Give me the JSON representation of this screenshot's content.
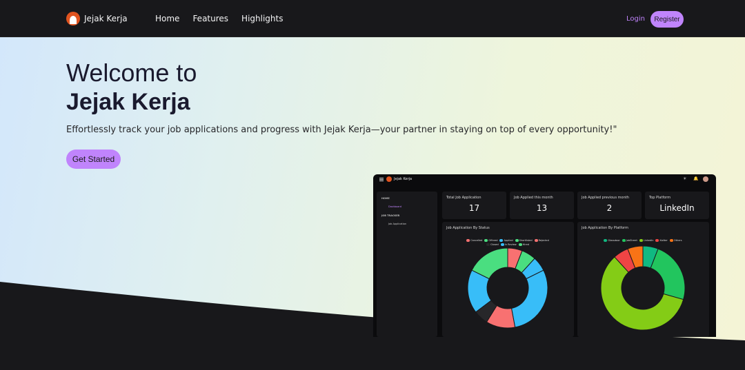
{
  "nav": {
    "brand": "Jejak Kerja",
    "links": [
      "Home",
      "Features",
      "Highlights"
    ],
    "login": "Login",
    "register": "Register"
  },
  "hero": {
    "title_line1": "Welcome to",
    "title_line2": "Jejak Kerja",
    "subtitle": "Effortlessly track your job applications and progress with Jejak Kerja—your partner in staying on top of every opportunity!\"",
    "cta": "Get Started"
  },
  "preview": {
    "brand": "Jejak Kerja",
    "sidebar": {
      "section_home": "HOME",
      "dashboard": "Dashboard",
      "section_tracker": "JOB TRACKER",
      "applications": "Job Application"
    },
    "stats": [
      {
        "label": "Total Job Application",
        "value": "17"
      },
      {
        "label": "Job Applied this month",
        "value": "13"
      },
      {
        "label": "Job Applied previous month",
        "value": "2"
      },
      {
        "label": "Top Platform",
        "value": "LinkedIn"
      }
    ],
    "status_panel": {
      "title": "Job Application By Status",
      "legend": [
        {
          "name": "Cancelled",
          "color": "#f87171"
        },
        {
          "name": "Offered",
          "color": "#4ade80"
        },
        {
          "name": "Applied",
          "color": "#38bdf8"
        },
        {
          "name": "Shortlisted",
          "color": "#4ade80"
        },
        {
          "name": "Rejected",
          "color": "#f87171"
        },
        {
          "name": "Closed",
          "color": "#27272a"
        },
        {
          "name": "In Review",
          "color": "#38bdf8"
        },
        {
          "name": "Hired",
          "color": "#4ade80"
        }
      ],
      "slices": [
        {
          "value": 1,
          "color": "#f87171"
        },
        {
          "value": 1,
          "color": "#4ade80"
        },
        {
          "value": 1,
          "color": "#38bdf8"
        },
        {
          "value": 5,
          "color": "#38bdf8"
        },
        {
          "value": 2,
          "color": "#f87171"
        },
        {
          "value": 1,
          "color": "#27272a"
        },
        {
          "value": 3,
          "color": "#38bdf8"
        },
        {
          "value": 3,
          "color": "#4ade80"
        }
      ]
    },
    "platform_panel": {
      "title": "Job Application By Platform",
      "legend": [
        {
          "name": "Glassdoor",
          "color": "#10b981"
        },
        {
          "name": "JobStreet",
          "color": "#22c55e"
        },
        {
          "name": "LinkedIn",
          "color": "#84cc16"
        },
        {
          "name": "Kalibrr",
          "color": "#ef4444"
        },
        {
          "name": "Others",
          "color": "#f97316"
        }
      ],
      "slices": [
        {
          "value": 1,
          "color": "#10b981"
        },
        {
          "value": 4,
          "color": "#22c55e"
        },
        {
          "value": 10,
          "color": "#84cc16"
        },
        {
          "value": 1,
          "color": "#ef4444"
        },
        {
          "value": 1,
          "color": "#f97316"
        }
      ]
    }
  }
}
